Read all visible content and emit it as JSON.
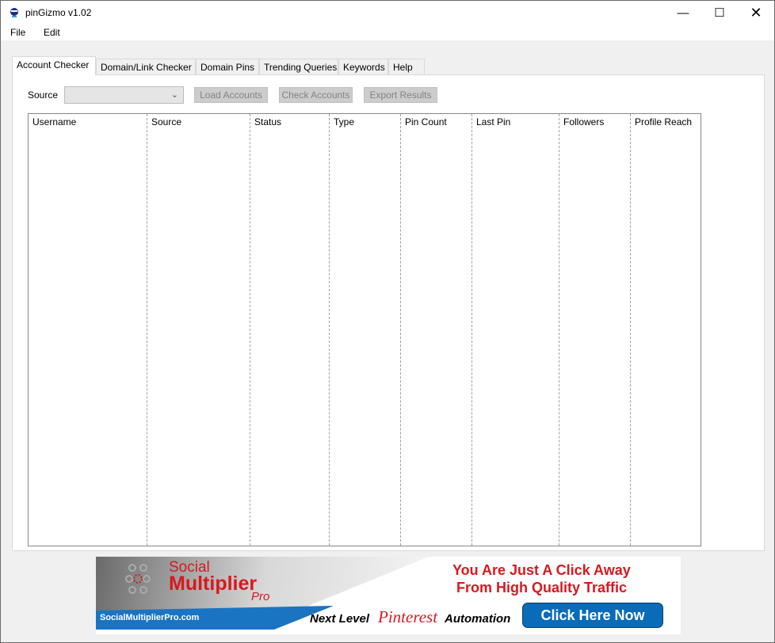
{
  "window": {
    "title": "pinGizmo v1.02"
  },
  "menu": [
    "File",
    "Edit"
  ],
  "tabs": [
    "Account Checker",
    "Domain/Link Checker",
    "Domain Pins",
    "Trending Queries",
    "Keywords",
    "Help"
  ],
  "toolbar": {
    "source_label": "Source",
    "source_value": "",
    "load": "Load Accounts",
    "check": "Check Accounts",
    "export": "Export Results"
  },
  "table": {
    "columns": [
      "Username",
      "Source",
      "Status",
      "Type",
      "Pin Count",
      "Last Pin",
      "Followers",
      "Profile Reach"
    ],
    "rows": []
  },
  "banner": {
    "brand1": "Social",
    "brand2": "Multiplier",
    "brand3": "Pro",
    "url": "SocialMultiplierPro.com",
    "headline1": "You Are Just A Click Away",
    "headline2": "From High Quality Traffic",
    "tagline_pre": "Next Level",
    "tagline_logo": "Pinterest",
    "tagline_post": "Automation",
    "cta": "Click Here Now"
  },
  "colors": {
    "accent_red": "#d7191f",
    "cta_blue": "#0a6bb8",
    "banner_blue": "#1a74c2"
  }
}
